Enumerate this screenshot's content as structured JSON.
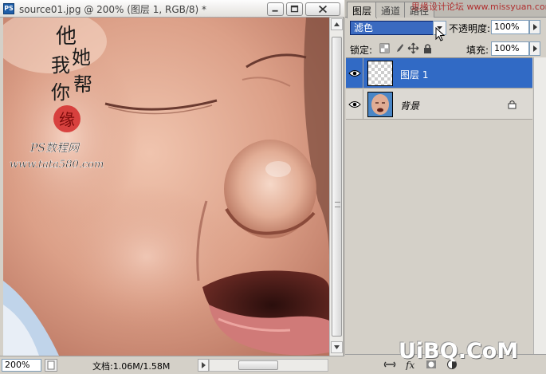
{
  "document": {
    "title": "source01.jpg @ 200% (图层 1, RGB/8) *",
    "app_icon": "PS",
    "zoom": "200%",
    "doc_size": "文档:1.06M/1.58M",
    "canvas_watermark": {
      "chars": [
        "他",
        "她",
        "我",
        "帮",
        "你"
      ],
      "seal": "缘",
      "site_name": "PS数程网",
      "site_url": "www.tata580.com"
    }
  },
  "layers_panel": {
    "tabs": [
      {
        "label": "图层",
        "active": true
      },
      {
        "label": "通道",
        "active": false
      },
      {
        "label": "路径",
        "active": false
      }
    ],
    "blend_mode": "滤色",
    "opacity_label": "不透明度:",
    "opacity_value": "100%",
    "lock_label": "锁定:",
    "fill_label": "填充:",
    "fill_value": "100%",
    "layers": [
      {
        "name": "图层 1",
        "selected": true,
        "visible": true,
        "locked": false
      },
      {
        "name": "背景",
        "selected": false,
        "visible": true,
        "locked": true
      }
    ]
  },
  "watermarks": {
    "top_right": "思缘设计论坛 www.missyuan.com",
    "bottom_right": "UiBQ.CoM"
  }
}
